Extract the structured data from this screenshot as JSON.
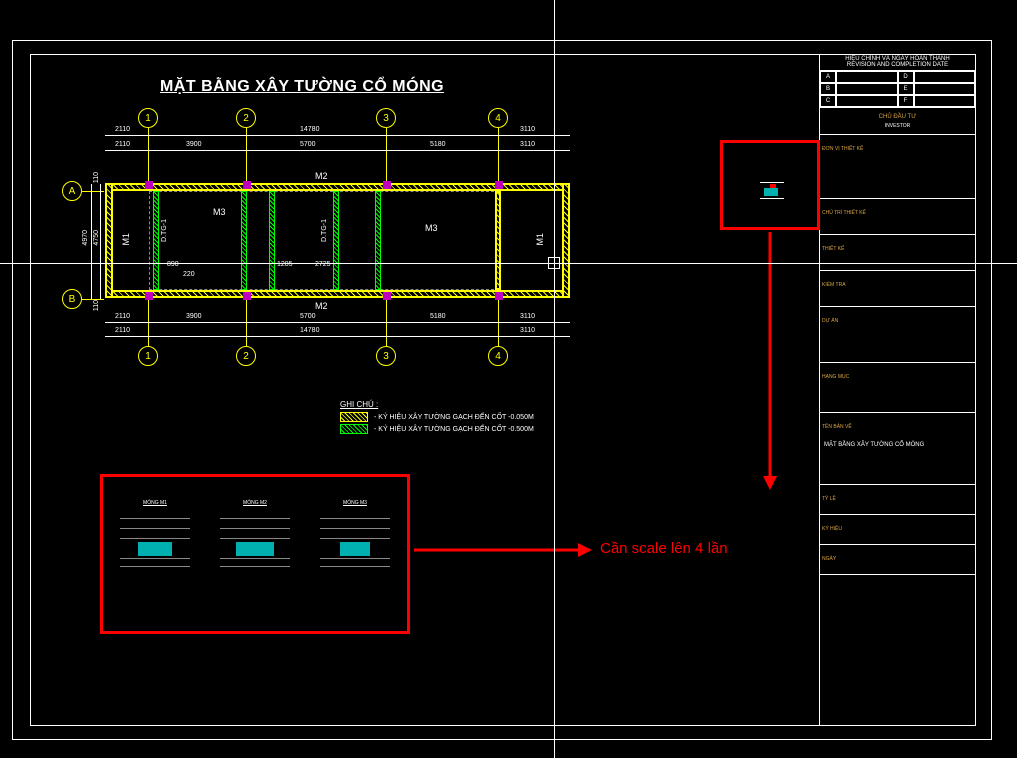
{
  "drawing": {
    "title": "MẶT BẰNG XÂY TƯỜNG CỔ MÓNG",
    "grids_h": [
      "1",
      "2",
      "3",
      "4"
    ],
    "grids_v": [
      "A",
      "B"
    ],
    "dims_top_outer": [
      "2110",
      "14780",
      "3110"
    ],
    "dims_top_inner": [
      "2110",
      "3900",
      "5700",
      "5180",
      "3110"
    ],
    "dims_bot_inner": [
      "2110",
      "3900",
      "5700",
      "5180",
      "3110"
    ],
    "dims_bot_outer": [
      "2110",
      "14780",
      "3110"
    ],
    "dims_left_outer": "4970",
    "dims_left_inner": "4750",
    "dims_side_top": "110",
    "dims_side_bot": "110",
    "dim_door1_w": "890",
    "dim_door1_off": "220",
    "dim_door2_w": "1285",
    "dim_door2_mid": "2725",
    "labels": {
      "m1_left": "M1",
      "m1_right": "M1",
      "m2_top": "M2",
      "m2_bot": "M2",
      "m3_a": "M3",
      "m3_b": "M3",
      "dtg1": "D.TG-1",
      "dtg2": "D.TG-1"
    }
  },
  "notes": {
    "heading": "GHI CHÚ :",
    "line1": "- KÝ HIỆU XÂY TƯỜNG GẠCH ĐẾN CỐT -0.050M",
    "line2": "- KÝ HIỆU XÂY TƯỜNG GẠCH ĐẾN CỐT -0.500M"
  },
  "annotation": {
    "text": "Cần scale lên 4 lần"
  },
  "details": {
    "d1": "MÓNG M1",
    "d2": "MÓNG M2",
    "d3": "MÓNG M3"
  },
  "titleblock": {
    "rev_header": "HIỆU CHỈNH VÀ NGÀY HOÀN THÀNH",
    "rev_header_en": "REVISION AND COMPLETION DATE",
    "rev_rows": [
      {
        "a": "A",
        "d": "D"
      },
      {
        "a": "B",
        "d": "E"
      },
      {
        "a": "C",
        "d": "F"
      }
    ],
    "owner": "CHỦ ĐẦU TƯ",
    "owner_en": "INVESTOR",
    "section_labels": [
      "ĐƠN VỊ THIẾT KẾ",
      "CHỦ TRÌ THIẾT KẾ",
      "THIẾT KẾ",
      "KIỂM TRA",
      "DỰ ÁN",
      "HẠNG MỤC",
      "TÊN BẢN VẼ",
      "TỶ LỆ",
      "KÝ HIỆU",
      "NGÀY"
    ],
    "drawing_name": "MẶT BẰNG XÂY TƯỜNG CỔ MÓNG"
  }
}
